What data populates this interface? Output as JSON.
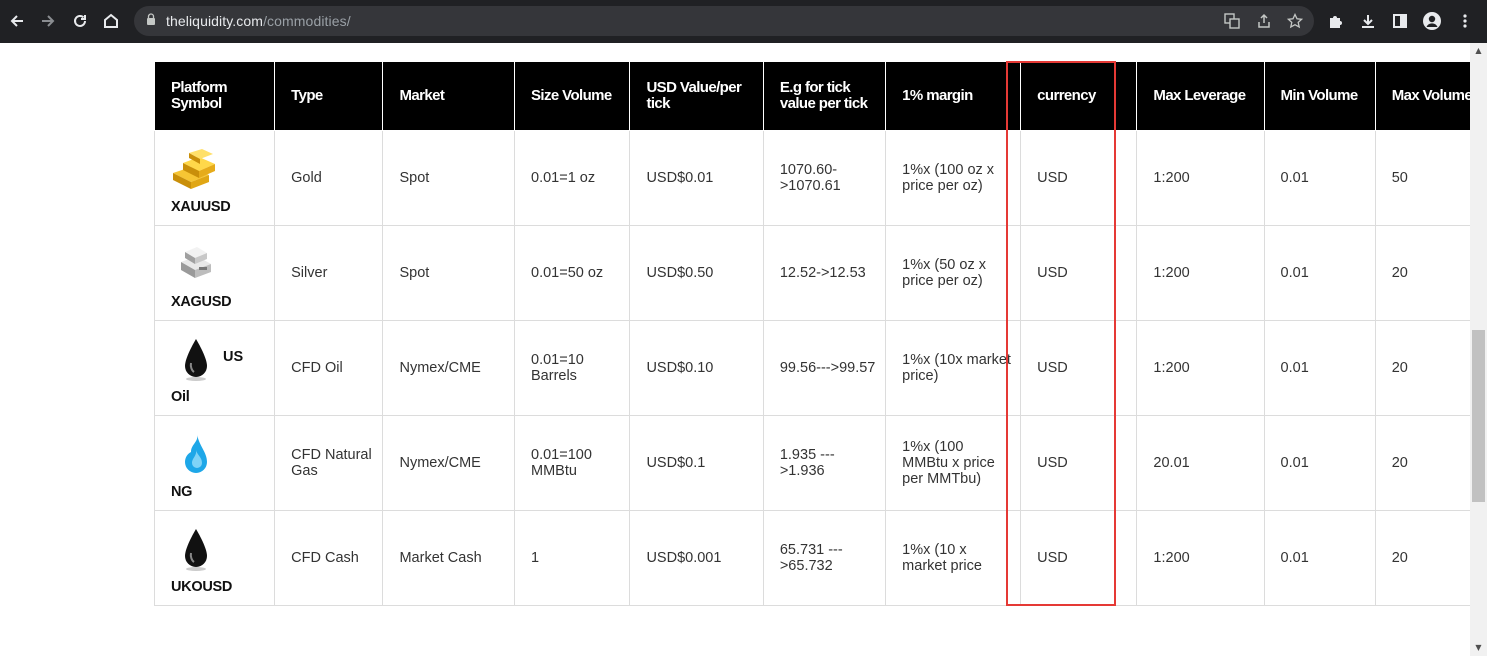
{
  "browser": {
    "url_host": "theliquidity.com",
    "url_path": "/commodities/"
  },
  "table": {
    "headers": [
      "Platform Symbol",
      "Type",
      "Market",
      "Size Volume",
      "USD Value/per tick",
      "E.g for tick value per tick",
      "1% margin",
      "currency",
      "Max Leverage",
      "Min Volume",
      "Max Volume"
    ],
    "rows": [
      {
        "symbol": "XAUUSD",
        "symbol_extra": "",
        "icon": "gold-bar-icon",
        "type": "Gold",
        "market": "Spot",
        "size": "0.01=1 oz",
        "usd_tick": "USD$0.01",
        "eg_tick": "1070.60->1070.61",
        "margin": "1%x (100 oz x price per oz)",
        "currency": "USD",
        "max_leverage": "1:200",
        "min_volume": "0.01",
        "max_volume": "50"
      },
      {
        "symbol": "XAGUSD",
        "symbol_extra": "",
        "icon": "silver-bar-icon",
        "type": "Silver",
        "market": "Spot",
        "size": "0.01=50 oz",
        "usd_tick": "USD$0.50",
        "eg_tick": "12.52->12.53",
        "margin": "1%x (50 oz x price per oz)",
        "currency": "USD",
        "max_leverage": "1:200",
        "min_volume": "0.01",
        "max_volume": "20"
      },
      {
        "symbol": "Oil",
        "symbol_extra": "US",
        "icon": "oil-drop-icon",
        "type": "CFD Oil",
        "market": "Nymex/CME",
        "size": "0.01=10 Barrels",
        "usd_tick": "USD$0.10",
        "eg_tick": "99.56--->99.57",
        "margin": "1%x (10x market price)",
        "currency": "USD",
        "max_leverage": "1:200",
        "min_volume": "0.01",
        "max_volume": "20"
      },
      {
        "symbol": "NG",
        "symbol_extra": "",
        "icon": "gas-flame-icon",
        "type": "CFD Natural Gas",
        "market": "Nymex/CME",
        "size": "0.01=100 MMBtu",
        "usd_tick": "USD$0.1",
        "eg_tick": "1.935 --->1.936",
        "margin": "1%x (100 MMBtu x price per MMTbu)",
        "currency": "USD",
        "max_leverage": "20.01",
        "min_volume": "0.01",
        "max_volume": "20"
      },
      {
        "symbol": "UKOUSD",
        "symbol_extra": "",
        "icon": "oil-drop-icon",
        "type": "CFD Cash",
        "market": "Market Cash",
        "size": "1",
        "usd_tick": "USD$0.001",
        "eg_tick": "65.731 --->65.732",
        "margin": "1%x (10 x market price",
        "currency": "USD",
        "max_leverage": "1:200",
        "min_volume": "0.01",
        "max_volume": "20"
      }
    ]
  },
  "colors": {
    "header_bg": "#000000",
    "highlight_border": "#e53935"
  }
}
